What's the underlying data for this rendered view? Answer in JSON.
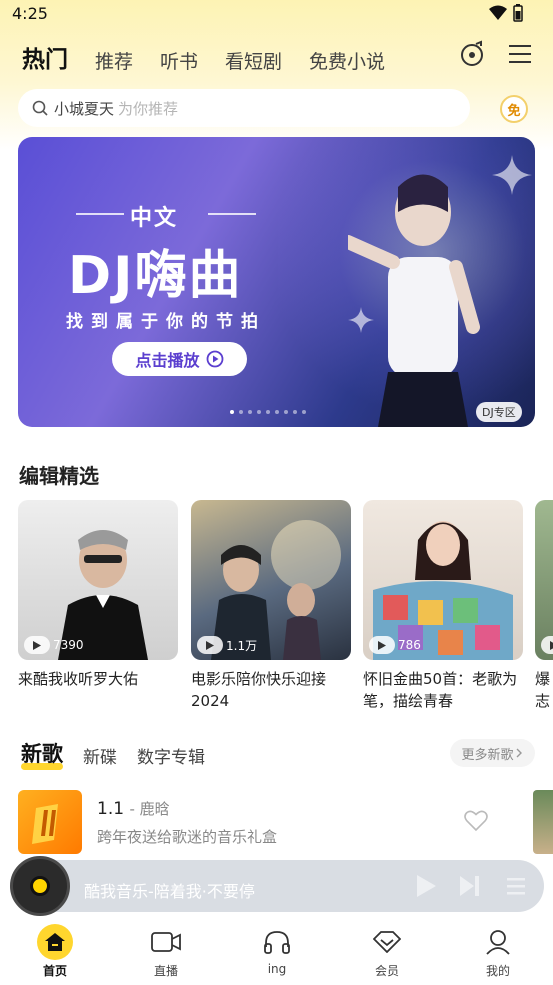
{
  "status": {
    "time": "4:25"
  },
  "header": {
    "tabs": [
      "热门",
      "推荐",
      "听书",
      "看短剧",
      "免费小说"
    ]
  },
  "search": {
    "keyword": "小城夏天",
    "hint": "为你推荐",
    "free_label": "免"
  },
  "banner": {
    "subtitle": "中文",
    "title": "DJ嗨曲",
    "slogan": "找到属于你的节拍",
    "button_label": "点击播放",
    "tag": "DJ专区",
    "dots_total": 9,
    "dots_active": 0
  },
  "editor_picks": {
    "title": "编辑精选",
    "cards": [
      {
        "title": "来酷我收听罗大佑",
        "plays": "7390",
        "color": "#d9d9d9"
      },
      {
        "title": "电影乐陪你快乐迎接2024",
        "plays": "1.1万",
        "color": "#4a5a70"
      },
      {
        "title": "怀旧金曲50首：老歌为笔，描绘青春",
        "plays": "786",
        "color": "#e8b9a0"
      },
      {
        "title": "爆志",
        "plays": "",
        "color": "#8aa070"
      }
    ]
  },
  "new_songs": {
    "tabs": [
      "新歌",
      "新碟",
      "数字专辑"
    ],
    "more_label": "更多新歌",
    "songs": [
      {
        "name": "1.1",
        "artist": "鹿晗",
        "desc": "跨年夜送给歌迷的音乐礼盒"
      }
    ]
  },
  "player": {
    "text": "酷我音乐-陪着我·不要停"
  },
  "bottom_nav": {
    "items": [
      "首页",
      "直播",
      "ing",
      "会员",
      "我的"
    ]
  }
}
